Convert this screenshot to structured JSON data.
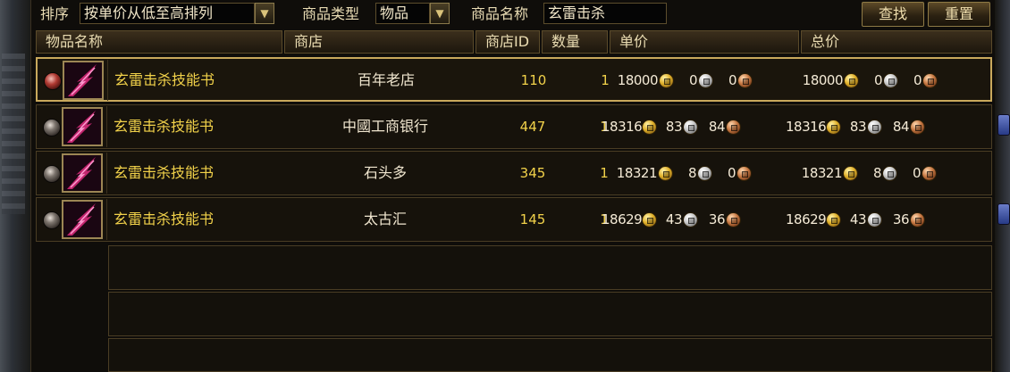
{
  "filters": {
    "sort_label": "排序",
    "sort_value": "按单价从低至高排列",
    "type_label": "商品类型",
    "type_value": "物品",
    "name_label": "商品名称",
    "name_value": "玄雷击杀",
    "search_button": "查找",
    "reset_button": "重置"
  },
  "columns": {
    "item_name": "物品名称",
    "shop": "商店",
    "shop_id": "商店ID",
    "quantity": "数量",
    "unit_price": "单价",
    "total_price": "总价"
  },
  "rows": [
    {
      "name": "玄雷击杀技能书",
      "shop": "百年老店",
      "shop_id": "110",
      "quantity": "1",
      "unit": {
        "gold": "18000",
        "silver": "0",
        "copper": "0"
      },
      "total": {
        "gold": "18000",
        "silver": "0",
        "copper": "0"
      }
    },
    {
      "name": "玄雷击杀技能书",
      "shop": "中國工商银行",
      "shop_id": "447",
      "quantity": "1",
      "unit": {
        "gold": "18316",
        "silver": "83",
        "copper": "84"
      },
      "total": {
        "gold": "18316",
        "silver": "83",
        "copper": "84"
      }
    },
    {
      "name": "玄雷击杀技能书",
      "shop": "石头多",
      "shop_id": "345",
      "quantity": "1",
      "unit": {
        "gold": "18321",
        "silver": "8",
        "copper": "0"
      },
      "total": {
        "gold": "18321",
        "silver": "8",
        "copper": "0"
      }
    },
    {
      "name": "玄雷击杀技能书",
      "shop": "太古汇",
      "shop_id": "145",
      "quantity": "1",
      "unit": {
        "gold": "18629",
        "silver": "43",
        "copper": "36"
      },
      "total": {
        "gold": "18629",
        "silver": "43",
        "copper": "36"
      }
    }
  ],
  "icons": {
    "item": "skill-book-icon",
    "gold": "gold-coin-icon",
    "silver": "silver-coin-icon",
    "copper": "copper-coin-icon",
    "dropdown": "chevron-down-icon"
  },
  "colors": {
    "item_name": "#f2d24a",
    "selection_border": "#c9a95c",
    "panel_bg": "#0f0d0a"
  }
}
